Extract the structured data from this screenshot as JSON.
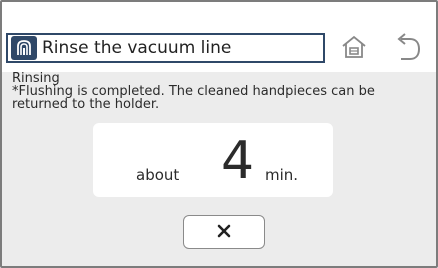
{
  "header": {
    "title": "Rinse the vacuum line",
    "title_icon": "vacuum-line-icon",
    "home_icon": "home-icon",
    "back_icon": "back-arrow-icon"
  },
  "status": {
    "label": "Rinsing",
    "message_line1": "*Flushing is completed. The cleaned handpieces can be",
    "message_line2": "returned to the holder."
  },
  "timer": {
    "prefix": "about",
    "value": "4",
    "unit": "min."
  },
  "close_button": {
    "icon": "close-icon"
  },
  "colors": {
    "accent": "#2f4868",
    "background": "#ececec"
  }
}
